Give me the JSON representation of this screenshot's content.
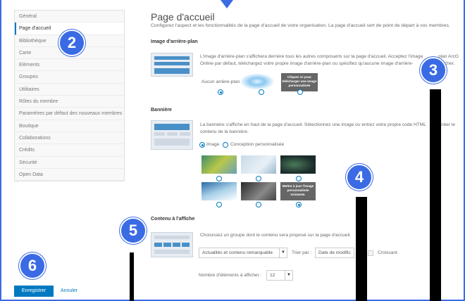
{
  "sidebar": {
    "items": [
      {
        "label": "Général"
      },
      {
        "label": "Page d'accueil",
        "active": true
      },
      {
        "label": "Bibliothèque"
      },
      {
        "label": "Carte"
      },
      {
        "label": "Eléments"
      },
      {
        "label": "Groupes"
      },
      {
        "label": "Utilitaires"
      },
      {
        "label": "Rôles du membre"
      },
      {
        "label": "Paramètres par défaut des nouveaux membres"
      },
      {
        "label": "Boutique"
      },
      {
        "label": "Collaborations"
      },
      {
        "label": "Crédits"
      },
      {
        "label": "Sécurité"
      },
      {
        "label": "Open Data"
      }
    ]
  },
  "page": {
    "title": "Page d'accueil",
    "subtitle": "Configurez l'aspect et les fonctionnalités de la page d'accueil de votre organisation. La page d'accueil sert de point de départ à vos membres."
  },
  "background": {
    "heading": "Image d'arrière-plan",
    "desc_line1": "L'image d'arrière-plan s'affichera derrière tous les autres composants sur la page d'accueil. Acceptez l'image",
    "desc_line1_tail": "plan ArcG",
    "desc_line2": "Online par défaut, téléchargez votre propre image d'arrière-plan ou spécifiez qu'aucune image d'arrière-",
    "desc_line2_tail": "fficher.",
    "none_label": "Aucun arrière-plan",
    "upload_label": "Cliquez ici pour télécharger une image personnalisée"
  },
  "banner": {
    "heading": "Bannière",
    "desc_line1": "La bannière s'affiche en haut de la page d'accueil. Sélectionnez une image ou entrez votre propre code HTML",
    "desc_line1_tail": "créer le",
    "desc_line2": "contenu de la bannière.",
    "option_image": "Image",
    "option_custom": "Conception personnalisée",
    "update_label": "Mettre à jour l'image personnalisée existante."
  },
  "featured": {
    "heading": "Contenu à l'affiche",
    "desc": "Choisissez un groupe dont le contenu sera proposé sur la page d'accueil.",
    "group_value": "Actualités et contenu remarquable",
    "sort_label": "Trier par :",
    "sort_value": "Date de modific",
    "ascending_label": "Croissant",
    "count_label": "Nombre d'éléments à afficher :",
    "count_value": "12"
  },
  "actions": {
    "save": "Enregistrer",
    "cancel": "Annuler"
  },
  "callouts": [
    "2",
    "3",
    "4",
    "5",
    "6"
  ],
  "colors": {
    "accent": "#0079c1",
    "callout": "#3b6be4"
  }
}
